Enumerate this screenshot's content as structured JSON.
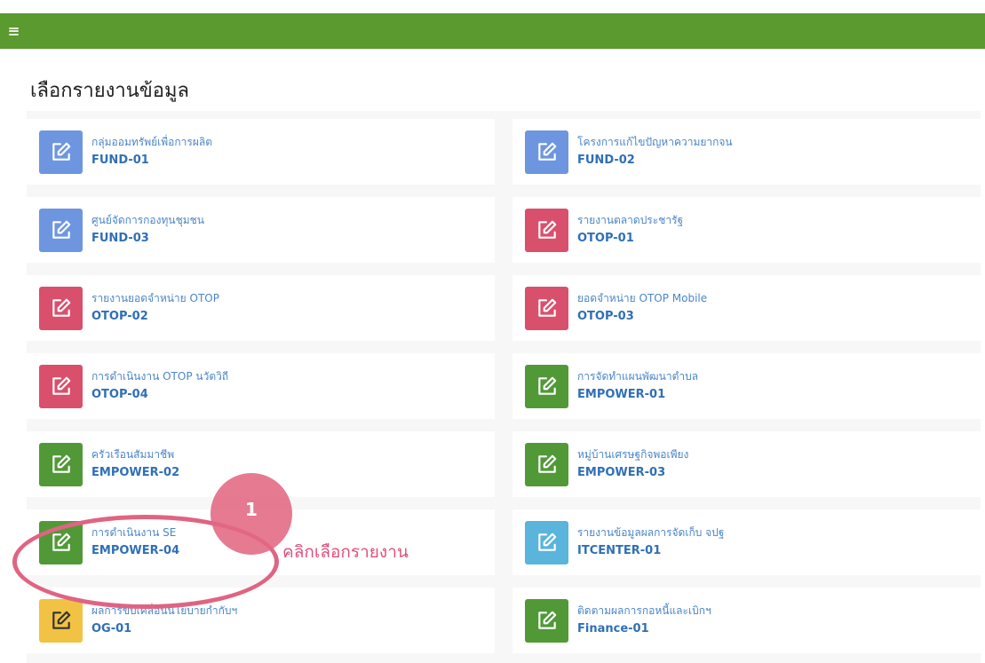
{
  "header": {
    "menu_icon": "hamburger-menu-icon",
    "color": "#5a9a2f"
  },
  "page": {
    "title": "เลือกรายงานข้อมูล"
  },
  "reports": [
    {
      "name": "กลุ่มออมทรัพย์เพื่อการผลิต",
      "code": "FUND-01",
      "color": "#6e96e0",
      "icon": "edit-icon"
    },
    {
      "name": "โครงการแก้ไขปัญหาความยากจน",
      "code": "FUND-02",
      "color": "#6e96e0",
      "icon": "edit-icon"
    },
    {
      "name": "ศูนย์จัดการกองทุนชุมชน",
      "code": "FUND-03",
      "color": "#6e96e0",
      "icon": "edit-icon"
    },
    {
      "name": "รายงานตลาดประชารัฐ",
      "code": "OTOP-01",
      "color": "#d9506c",
      "icon": "edit-icon"
    },
    {
      "name": "รายงานยอดจำหน่าย OTOP",
      "code": "OTOP-02",
      "color": "#d9506c",
      "icon": "edit-icon"
    },
    {
      "name": "ยอดจำหน่าย OTOP Mobile",
      "code": "OTOP-03",
      "color": "#d9506c",
      "icon": "edit-icon"
    },
    {
      "name": "การดำเนินงาน OTOP นวัตวิถี",
      "code": "OTOP-04",
      "color": "#d9506c",
      "icon": "edit-icon"
    },
    {
      "name": "การจัดทำแผนพัฒนาตำบล",
      "code": "EMPOWER-01",
      "color": "#519937",
      "icon": "edit-icon"
    },
    {
      "name": "ครัวเรือนสัมมาชีพ",
      "code": "EMPOWER-02",
      "color": "#519937",
      "icon": "edit-icon"
    },
    {
      "name": "หมู่บ้านเศรษฐกิจพอเพียง",
      "code": "EMPOWER-03",
      "color": "#519937",
      "icon": "edit-icon"
    },
    {
      "name": "การดำเนินงาน SE",
      "code": "EMPOWER-04",
      "color": "#519937",
      "icon": "edit-icon"
    },
    {
      "name": "รายงานข้อมูลผลการจัดเก็บ จปฐ",
      "code": "ITCENTER-01",
      "color": "#5ab4dc",
      "icon": "edit-icon"
    },
    {
      "name": "ผลการขับเคลื่อนนโยบายกำกับฯ",
      "code": "OG-01",
      "color": "#f2c244",
      "icon": "edit-icon"
    },
    {
      "name": "ติดตามผลการกอหนี้และเบิกฯ",
      "code": "Finance-01",
      "color": "#519937",
      "icon": "edit-icon"
    }
  ],
  "annotation": {
    "step": "1",
    "text": "คลิกเลือกรายงาน",
    "color": "#e0507a"
  }
}
